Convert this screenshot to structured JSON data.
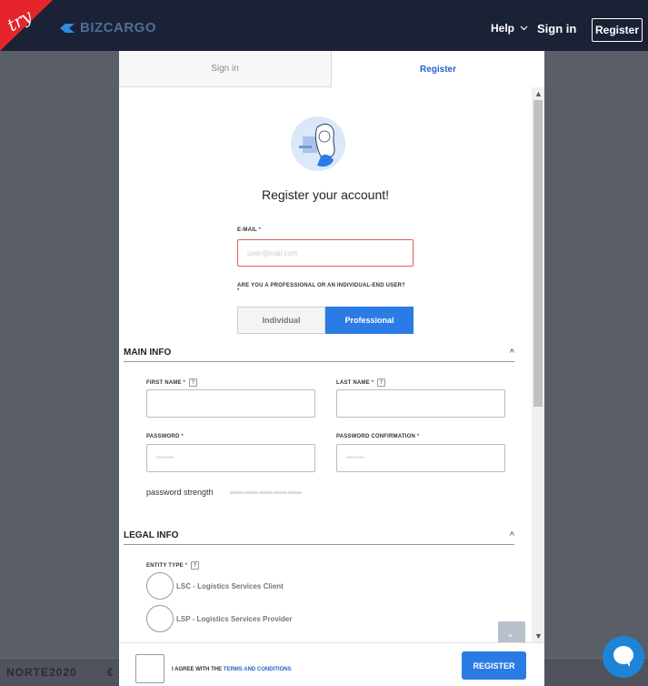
{
  "header": {
    "try_label": "try",
    "brand": "BIZCARGO",
    "help": "Help",
    "signin": "Sign in",
    "register": "Register"
  },
  "tabs": [
    {
      "label": "Sign in",
      "active": false
    },
    {
      "label": "Register",
      "active": true
    }
  ],
  "title": "Register your account!",
  "email": {
    "label": "E-MAIL",
    "required": "*",
    "placeholder": "user@mail.com"
  },
  "user_type": {
    "question": "ARE YOU A PROFESSIONAL OR AN INDIVIDUAL-END USER?",
    "required": "*",
    "options": [
      "Individual",
      "Professional"
    ],
    "selected": "Professional"
  },
  "main_info": {
    "heading": "MAIN INFO",
    "first_name": {
      "label": "FIRST NAME",
      "required": "*",
      "help": "?"
    },
    "last_name": {
      "label": "LAST NAME",
      "required": "*",
      "help": "?"
    },
    "password": {
      "label": "PASSWORD",
      "required": "*",
      "placeholder": "••••••••"
    },
    "password_confirm": {
      "label": "PASSWORD CONFIRMATION",
      "required": "*",
      "placeholder": "••••••••"
    },
    "strength_label": "password strength"
  },
  "legal_info": {
    "heading": "LEGAL INFO",
    "entity_type": {
      "label": "ENTITY TYPE",
      "required": "*",
      "help": "?"
    },
    "options": [
      "LSC - Logistics Services Client",
      "LSP - Logistics Services Provider"
    ]
  },
  "footer": {
    "agree_prefix": "I AGREE WITH THE",
    "agree_link": "TERMS AND CONDITIONS",
    "register_button": "REGISTER"
  },
  "page_footer": {
    "logo": "NORTE2020"
  },
  "colors": {
    "accent": "#2b7be4",
    "navbar": "#1c2235",
    "error": "#e35a5a",
    "try_red": "#e5242b"
  }
}
